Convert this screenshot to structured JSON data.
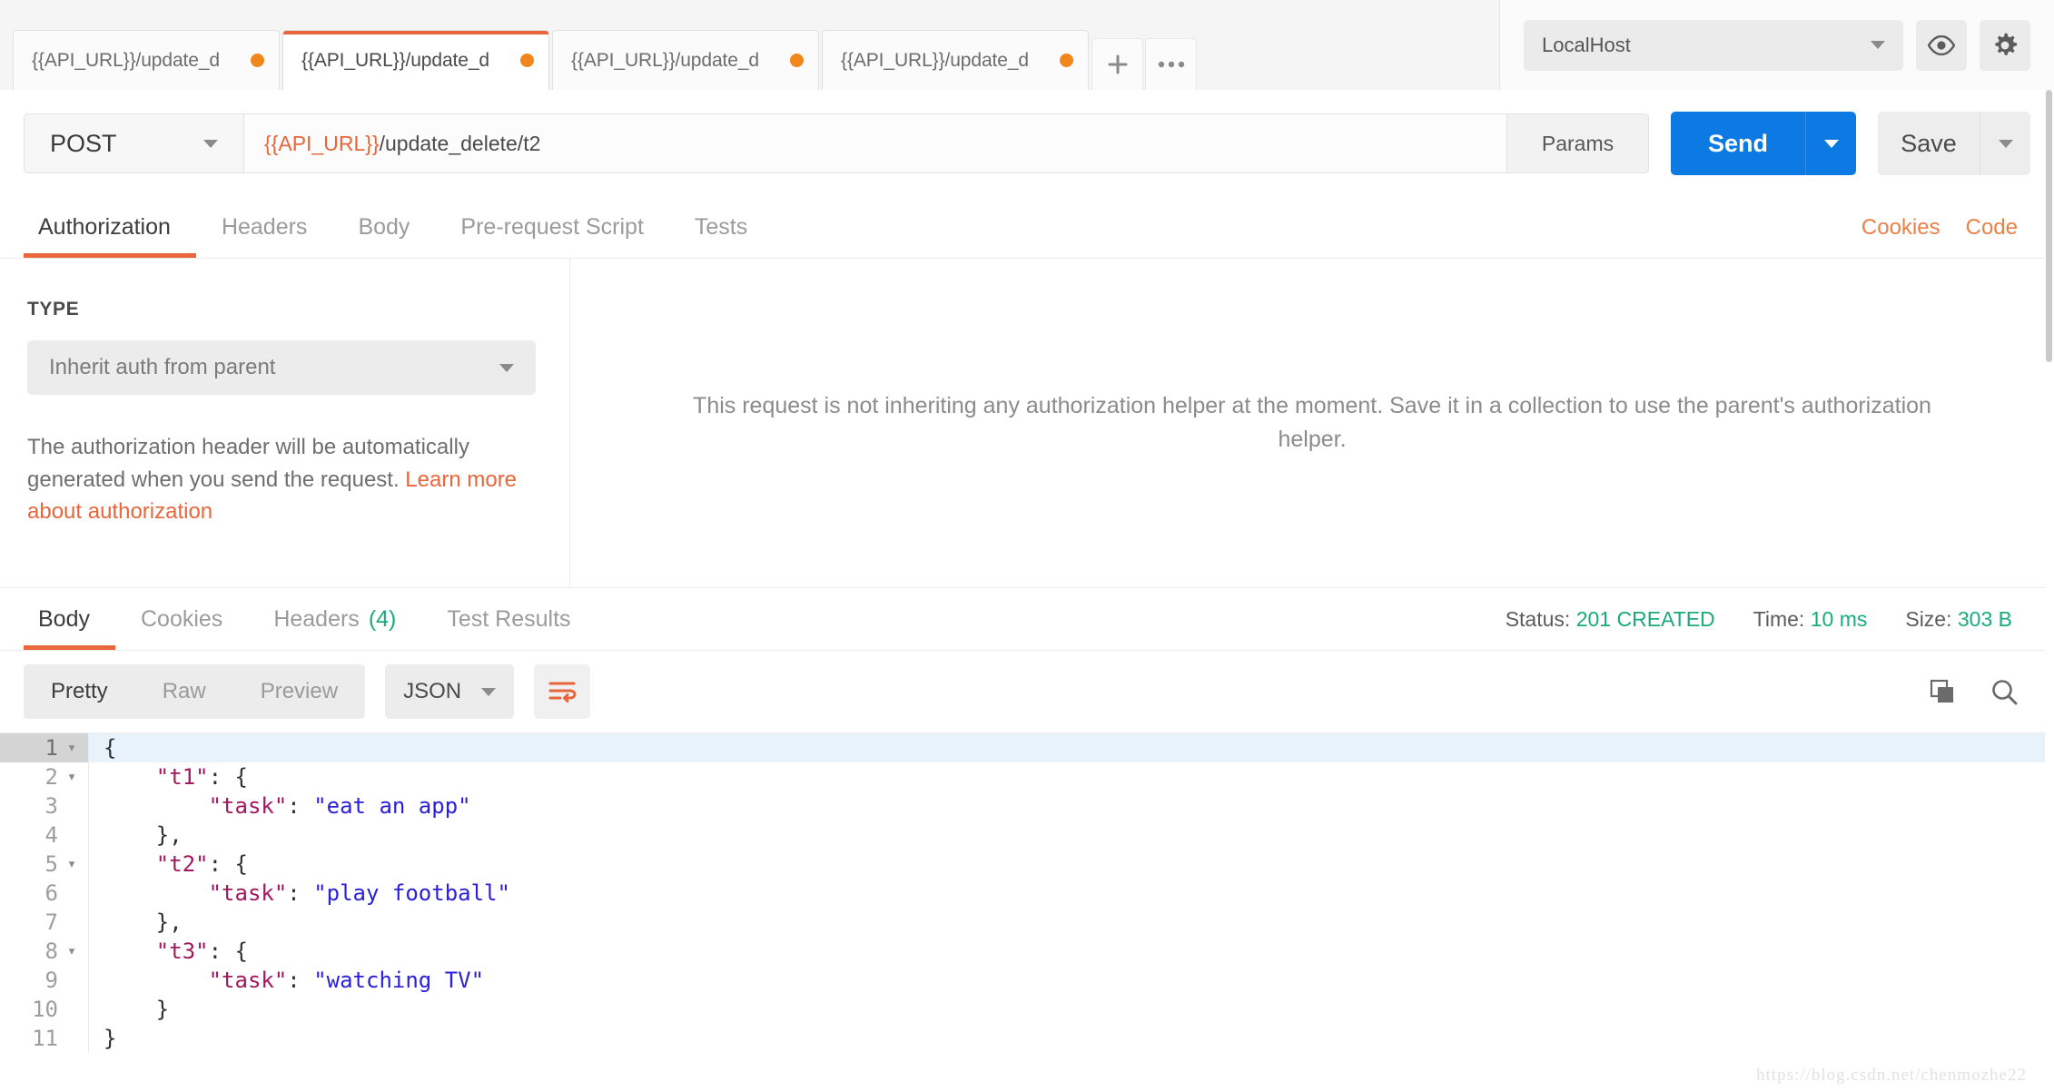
{
  "tabbar": {
    "tabs": [
      {
        "label": "{{API_URL}}/update_d",
        "active": false,
        "unsaved": true
      },
      {
        "label": "{{API_URL}}/update_d",
        "active": true,
        "unsaved": true
      },
      {
        "label": "{{API_URL}}/update_d",
        "active": false,
        "unsaved": true
      },
      {
        "label": "{{API_URL}}/update_d",
        "active": false,
        "unsaved": true
      }
    ],
    "new_tab_icon": "plus-icon",
    "more_icon": "ellipsis-icon",
    "environment": {
      "selected": "LocalHost",
      "chevron": "chevron-down-icon"
    },
    "eye_icon": "eye-icon",
    "gear_icon": "gear-icon"
  },
  "urlbar": {
    "method": "POST",
    "url_variable": "{{API_URL}}",
    "url_rest": "/update_delete/t2",
    "url_full": "{{API_URL}}/update_delete/t2",
    "params_label": "Params",
    "send_label": "Send",
    "save_label": "Save",
    "send_color": "#0d7ae4"
  },
  "request_tabs": {
    "items": [
      {
        "label": "Authorization",
        "active": true
      },
      {
        "label": "Headers",
        "active": false
      },
      {
        "label": "Body",
        "active": false
      },
      {
        "label": "Pre-request Script",
        "active": false
      },
      {
        "label": "Tests",
        "active": false
      }
    ],
    "cookies_label": "Cookies",
    "code_label": "Code",
    "accent_color": "#e8663a"
  },
  "auth_panel": {
    "type_label": "TYPE",
    "type_value": "Inherit auth from parent",
    "description_text": "The authorization header will be automatically generated when you send the request. ",
    "description_link": "Learn more about authorization",
    "empty_message": "This request is not inheriting any authorization helper at the moment. Save it in a collection to use the parent's authorization helper."
  },
  "response_tabs": {
    "items": [
      {
        "label": "Body",
        "active": true,
        "count": ""
      },
      {
        "label": "Cookies",
        "active": false,
        "count": ""
      },
      {
        "label": "Headers",
        "active": false,
        "count": "(4)"
      },
      {
        "label": "Test Results",
        "active": false,
        "count": ""
      }
    ],
    "status_label": "Status:",
    "status_value": "201 CREATED",
    "time_label": "Time:",
    "time_value": "10 ms",
    "size_label": "Size:",
    "size_value": "303 B",
    "value_color": "#1aab7b"
  },
  "format_bar": {
    "modes": [
      {
        "label": "Pretty",
        "active": true
      },
      {
        "label": "Raw",
        "active": false
      },
      {
        "label": "Preview",
        "active": false
      }
    ],
    "language": "JSON",
    "wrap_icon": "word-wrap-icon",
    "copy_icon": "copy-icon",
    "search_icon": "search-icon"
  },
  "response_body": {
    "language": "json",
    "lines": [
      {
        "n": "1",
        "fold": true,
        "active": true,
        "parts": [
          {
            "t": "{",
            "c": "j-pun"
          }
        ],
        "indent": ""
      },
      {
        "n": "2",
        "fold": true,
        "active": false,
        "parts": [
          {
            "t": "\"t1\"",
            "c": "j-key"
          },
          {
            "t": ": {",
            "c": "j-pun"
          }
        ],
        "indent": "    "
      },
      {
        "n": "3",
        "fold": false,
        "active": false,
        "parts": [
          {
            "t": "\"task\"",
            "c": "j-key"
          },
          {
            "t": ": ",
            "c": "j-pun"
          },
          {
            "t": "\"eat an app\"",
            "c": "j-str"
          }
        ],
        "indent": "        "
      },
      {
        "n": "4",
        "fold": false,
        "active": false,
        "parts": [
          {
            "t": "},",
            "c": "j-pun"
          }
        ],
        "indent": "    "
      },
      {
        "n": "5",
        "fold": true,
        "active": false,
        "parts": [
          {
            "t": "\"t2\"",
            "c": "j-key"
          },
          {
            "t": ": {",
            "c": "j-pun"
          }
        ],
        "indent": "    "
      },
      {
        "n": "6",
        "fold": false,
        "active": false,
        "parts": [
          {
            "t": "\"task\"",
            "c": "j-key"
          },
          {
            "t": ": ",
            "c": "j-pun"
          },
          {
            "t": "\"play football\"",
            "c": "j-str"
          }
        ],
        "indent": "        "
      },
      {
        "n": "7",
        "fold": false,
        "active": false,
        "parts": [
          {
            "t": "},",
            "c": "j-pun"
          }
        ],
        "indent": "    "
      },
      {
        "n": "8",
        "fold": true,
        "active": false,
        "parts": [
          {
            "t": "\"t3\"",
            "c": "j-key"
          },
          {
            "t": ": {",
            "c": "j-pun"
          }
        ],
        "indent": "    "
      },
      {
        "n": "9",
        "fold": false,
        "active": false,
        "parts": [
          {
            "t": "\"task\"",
            "c": "j-key"
          },
          {
            "t": ": ",
            "c": "j-pun"
          },
          {
            "t": "\"watching TV\"",
            "c": "j-str"
          }
        ],
        "indent": "        "
      },
      {
        "n": "10",
        "fold": false,
        "active": false,
        "parts": [
          {
            "t": "}",
            "c": "j-pun"
          }
        ],
        "indent": "    "
      },
      {
        "n": "11",
        "fold": false,
        "active": false,
        "parts": [
          {
            "t": "}",
            "c": "j-pun"
          }
        ],
        "indent": ""
      }
    ],
    "raw_json": {
      "t1": {
        "task": "eat an app"
      },
      "t2": {
        "task": "play football"
      },
      "t3": {
        "task": "watching TV"
      }
    }
  },
  "watermark": "https://blog.csdn.net/chenmozhe22"
}
